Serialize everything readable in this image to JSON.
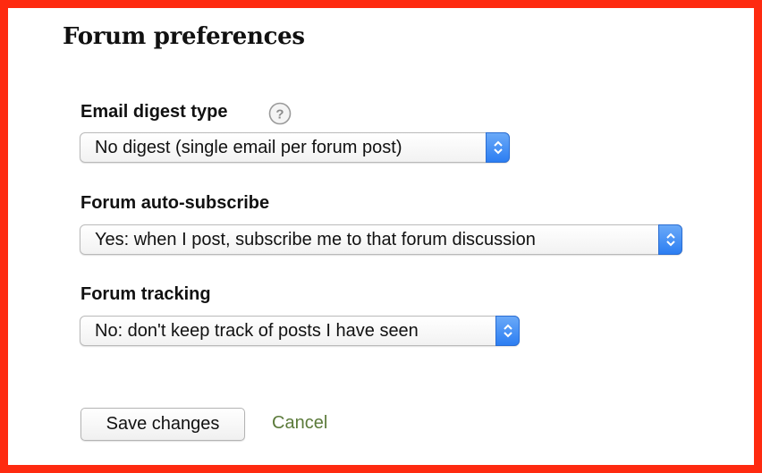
{
  "page": {
    "title": "Forum preferences"
  },
  "form": {
    "email_digest": {
      "label": "Email digest type",
      "help_icon": "question-circle-icon",
      "value": "No digest (single email per forum post)"
    },
    "auto_subscribe": {
      "label": "Forum auto-subscribe",
      "value": "Yes: when I post, subscribe me to that forum discussion"
    },
    "tracking": {
      "label": "Forum tracking",
      "value": "No: don't keep track of posts I have seen"
    }
  },
  "actions": {
    "save_label": "Save changes",
    "cancel_label": "Cancel"
  },
  "colors": {
    "frame_border": "#fe2a10",
    "select_stepper": "#2c7ef2",
    "cancel_link": "#5b7a3a"
  }
}
